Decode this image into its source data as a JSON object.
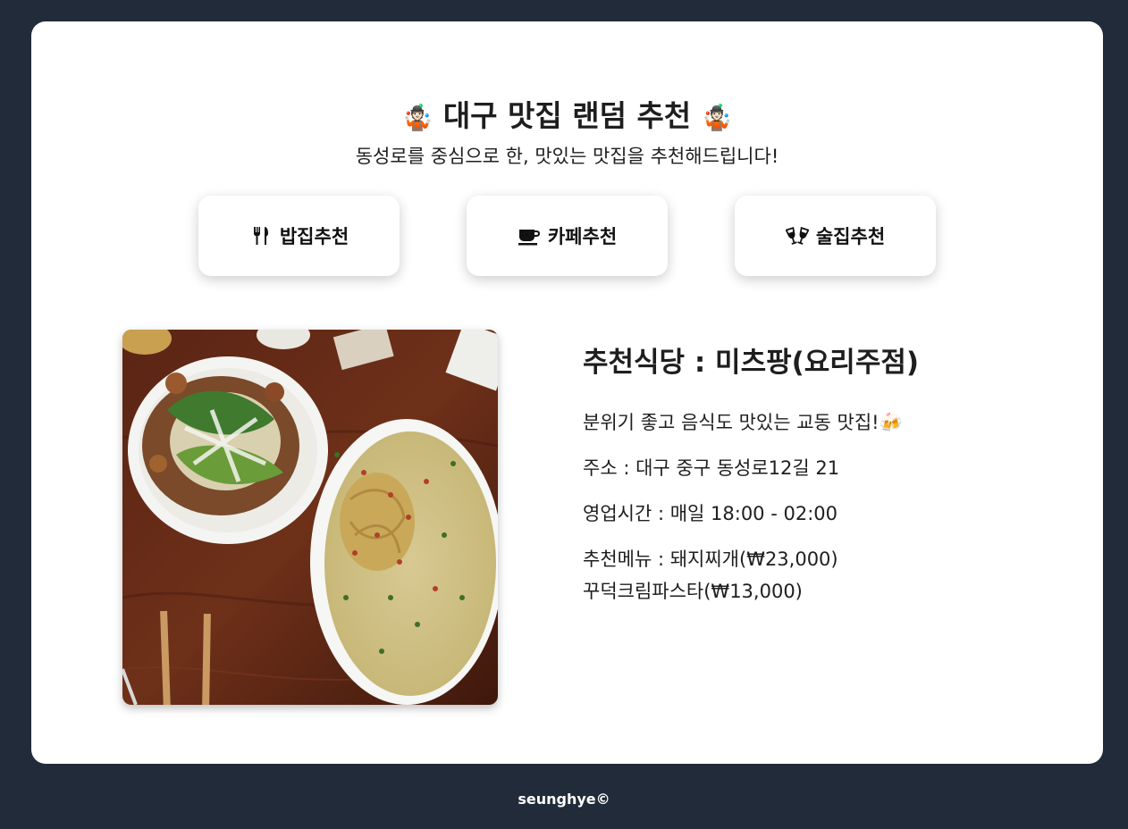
{
  "header": {
    "title": "대구 맛집 랜덤 추천",
    "title_emoji_left": "🤹🏻",
    "title_emoji_right": "🤹🏻",
    "subtitle": "동성로를 중심으로 한, 맛있는 맛집을 추천해드립니다!"
  },
  "categories": [
    {
      "label": "밥집추천",
      "icon": "fork-knife-icon"
    },
    {
      "label": "카페추천",
      "icon": "coffee-cup-icon"
    },
    {
      "label": "술집추천",
      "icon": "clinking-glasses-icon"
    }
  ],
  "result": {
    "name": "추천식당 : 미츠팡(요리주점)",
    "description": "분위기 좋고 음식도 맛있는 교동 맛집!",
    "description_emoji": "🍻",
    "address": "주소 : 대구 중구 동성로12길 21",
    "hours": "영업시간 : 매일 18:00 - 02:00",
    "menu_line1": "추천메뉴 : 돼지찌개(₩23,000)",
    "menu_line2": "꾸덕크림파스타(₩13,000)",
    "photo": "food-photo"
  },
  "footer": {
    "text": "seunghye©"
  },
  "colors": {
    "page_background": "#222b39",
    "card_background": "#ffffff",
    "text": "#1e1e1e",
    "footer_text": "#ffffff"
  }
}
